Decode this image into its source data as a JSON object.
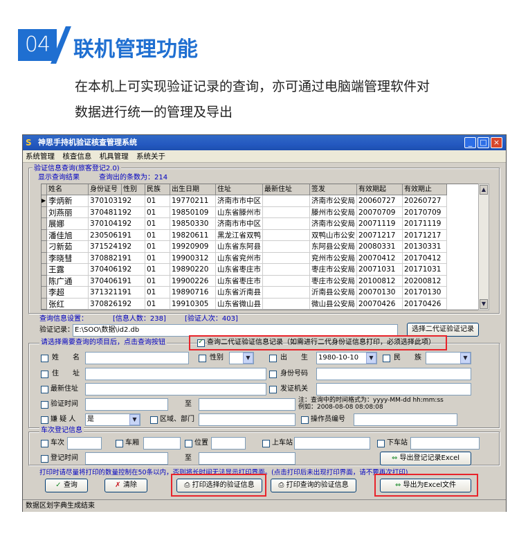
{
  "header": {
    "number": "04",
    "title": "联机管理功能",
    "intro_line1": "在本机上可实现验证记录的查询，亦可通过电脑端管理软件对",
    "intro_line2": "数据进行统一的管理及导出"
  },
  "window": {
    "icon_label": "S",
    "title": "神思手持机验证核查管理系统",
    "controls": {
      "minimize": "_",
      "maximize": "□",
      "close": "×"
    },
    "menu": [
      "系统管理",
      "核查信息",
      "机具管理",
      "系统关于"
    ]
  },
  "query_group": {
    "label": "验证信息查询(旅客登记2.0)",
    "result_label": "显示查询结果",
    "count_label": "查询出的条数为：214"
  },
  "table": {
    "columns": [
      "姓名",
      "身份证号",
      "性别",
      "民族",
      "出生日期",
      "住址",
      "最新住址",
      "签发",
      "有效期起",
      "有效期止"
    ],
    "rows": [
      [
        "李炳新",
        "370103192",
        "01",
        "19770211",
        "济南市市中区",
        "",
        "济南市公安局",
        "20060727",
        "20260727"
      ],
      [
        "刘燕丽",
        "370481192",
        "01",
        "19850109",
        "山东省滕州市",
        "",
        "滕州市公安局",
        "20070709",
        "20170709"
      ],
      [
        "展娜",
        "370104192",
        "01",
        "19850330",
        "济南市市中区",
        "",
        "济南市公安局",
        "20071119",
        "20171119"
      ],
      [
        "潘佳旭",
        "230506191",
        "01",
        "19820611",
        "黑龙江省双鸭",
        "",
        "双鸭山市公安",
        "20071217",
        "20171217"
      ],
      [
        "刁新茹",
        "371524192",
        "01",
        "19920909",
        "山东省东阿县",
        "",
        "东阿县公安局",
        "20080331",
        "20130331"
      ],
      [
        "李晓彗",
        "370882191",
        "01",
        "19900312",
        "山东省兖州市",
        "",
        "兖州市公安局",
        "20070412",
        "20170412"
      ],
      [
        "王露",
        "370406192",
        "01",
        "19890220",
        "山东省枣庄市",
        "",
        "枣庄市公安局",
        "20071031",
        "20171031"
      ],
      [
        "陈广通",
        "370406191",
        "01",
        "19900226",
        "山东省枣庄市",
        "",
        "枣庄市公安局",
        "20100812",
        "20200812"
      ],
      [
        "李超",
        "371321191",
        "01",
        "19890716",
        "山东省沂南县",
        "",
        "沂南县公安局",
        "20070130",
        "20170130"
      ],
      [
        "张红",
        "370826192",
        "01",
        "19910305",
        "山东省微山县",
        "",
        "微山县公安局",
        "20070426",
        "20170426"
      ]
    ]
  },
  "settings": {
    "label": "查询信息设置：",
    "people_count": "[信息人数：238]",
    "visit_count": "[验证人次：403]",
    "record_label": "验证记录：",
    "record_path": "E:\\SOO\\数据\\id2.db",
    "choose_button": "选择二代证验证记录"
  },
  "search": {
    "prompt": "请选择需要查询的项目后，点击查询按钮",
    "query_id2_checkbox": "查询二代证验证信息记录（如需进行二代身份证信息打印，必须选择此项）",
    "name_label": "姓　　名",
    "gender_label": "性别",
    "birth_label": "出　　生",
    "birth_value": "1980-10-10",
    "ethnic_label": "民　　族",
    "address_label": "住　　址",
    "idnum_label": "身份号码",
    "latest_address_label": "最新住址",
    "issuer_label": "发证机关",
    "verify_time_label": "验证时间",
    "to_label": "至",
    "time_note1": "注：查询中的时间格式为：yyyy-MM-dd hh:mm:ss",
    "time_note2": "例如：2008-08-08 08:08:08",
    "suspect_label": "嫌 疑 人",
    "suspect_value": "是",
    "region_label": "区域、部门",
    "operator_label": "操作员编号"
  },
  "train": {
    "label": "车次登记信息",
    "train_no": "车次",
    "carriage": "车厢",
    "seat": "位置",
    "board": "上车站",
    "alight": "下车站",
    "reg_time": "登记时间",
    "to_label": "至",
    "export_reg_button": "导出登记记录Excel"
  },
  "print_note": "打印时请尽量将打印的数量控制在50条以内，否则将长时间无法显示打印界面。(点击打印后未出现打印界面，请不要再次打印)",
  "buttons": {
    "query": "查询",
    "clear": "清除",
    "print_selected": "打印选择的验证信息",
    "print_query": "打印查询的验证信息",
    "export_excel": "导出为Excel文件"
  },
  "status": "数据区划字典生成结束",
  "colors": {
    "accent": "#1f6fd1",
    "highlight": "#e8232a",
    "titlebar": "#2459c0"
  }
}
